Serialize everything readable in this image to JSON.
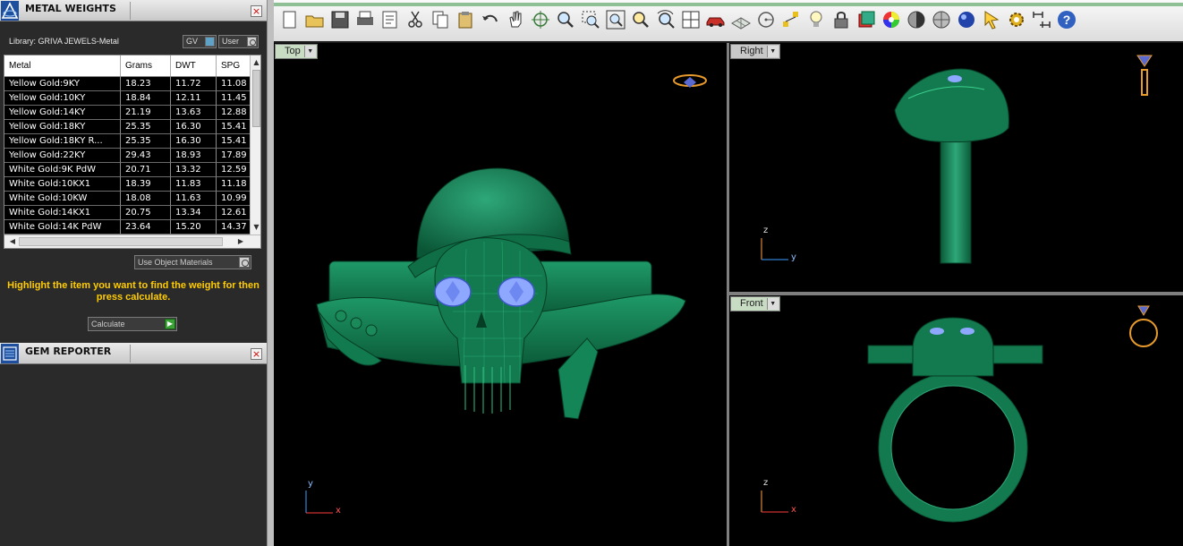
{
  "metal_panel": {
    "title": "METAL WEIGHTS",
    "library_label": "Library: GRIVA JEWELS-Metal",
    "gv_label": "GV",
    "user_label": "User",
    "columns": [
      "Metal",
      "Grams",
      "DWT",
      "SPG"
    ],
    "rows": [
      [
        "Yellow Gold:9KY",
        "18.23",
        "11.72",
        "11.08"
      ],
      [
        "Yellow Gold:10KY",
        "18.84",
        "12.11",
        "11.45"
      ],
      [
        "Yellow Gold:14KY",
        "21.19",
        "13.63",
        "12.88"
      ],
      [
        "Yellow Gold:18KY",
        "25.35",
        "16.30",
        "15.41"
      ],
      [
        "Yellow Gold:18KY R...",
        "25.35",
        "16.30",
        "15.41"
      ],
      [
        "Yellow Gold:22KY",
        "29.43",
        "18.93",
        "17.89"
      ],
      [
        "White Gold:9K PdW",
        "20.71",
        "13.32",
        "12.59"
      ],
      [
        "White Gold:10KX1",
        "18.39",
        "11.83",
        "11.18"
      ],
      [
        "White Gold:10KW",
        "18.08",
        "11.63",
        "10.99"
      ],
      [
        "White Gold:14KX1",
        "20.75",
        "13.34",
        "12.61"
      ],
      [
        "White Gold:14K PdW",
        "23.64",
        "15.20",
        "14.37"
      ]
    ],
    "use_object_materials": "Use Object Materials",
    "hint": "Highlight the item you want to find the weight for then press calculate.",
    "calculate_label": "Calculate"
  },
  "gem_panel": {
    "title": "GEM REPORTER"
  },
  "viewports": {
    "top": {
      "label": "Top",
      "axis_v": "y",
      "axis_h": "x"
    },
    "right": {
      "label": "Right",
      "axis_v": "z",
      "axis_h": "y"
    },
    "front": {
      "label": "Front",
      "axis_v": "z",
      "axis_h": "x"
    }
  },
  "toolbar_icons": [
    "new-icon",
    "open-icon",
    "save-icon",
    "print-icon",
    "properties-icon",
    "cut-icon",
    "copy-icon",
    "paste-icon",
    "undo-icon",
    "pan-icon",
    "rotate-icon",
    "zoom-icon",
    "zoom-window-icon",
    "zoom-extents-icon",
    "zoom-selected-icon",
    "zoom-dynamic-icon",
    "four-views-icon",
    "car-icon",
    "grid-icon",
    "snap-icon",
    "points-icon",
    "light-icon",
    "lock-icon",
    "layers-icon",
    "color-wheel-icon",
    "shade-icon",
    "render-icon",
    "sphere-icon",
    "select-icon",
    "settings-icon",
    "dimension-icon",
    "help-icon"
  ],
  "colors": {
    "model": "#127a4e",
    "gem": "#8fa8ff",
    "accent_yellow": "#ffcc00"
  }
}
